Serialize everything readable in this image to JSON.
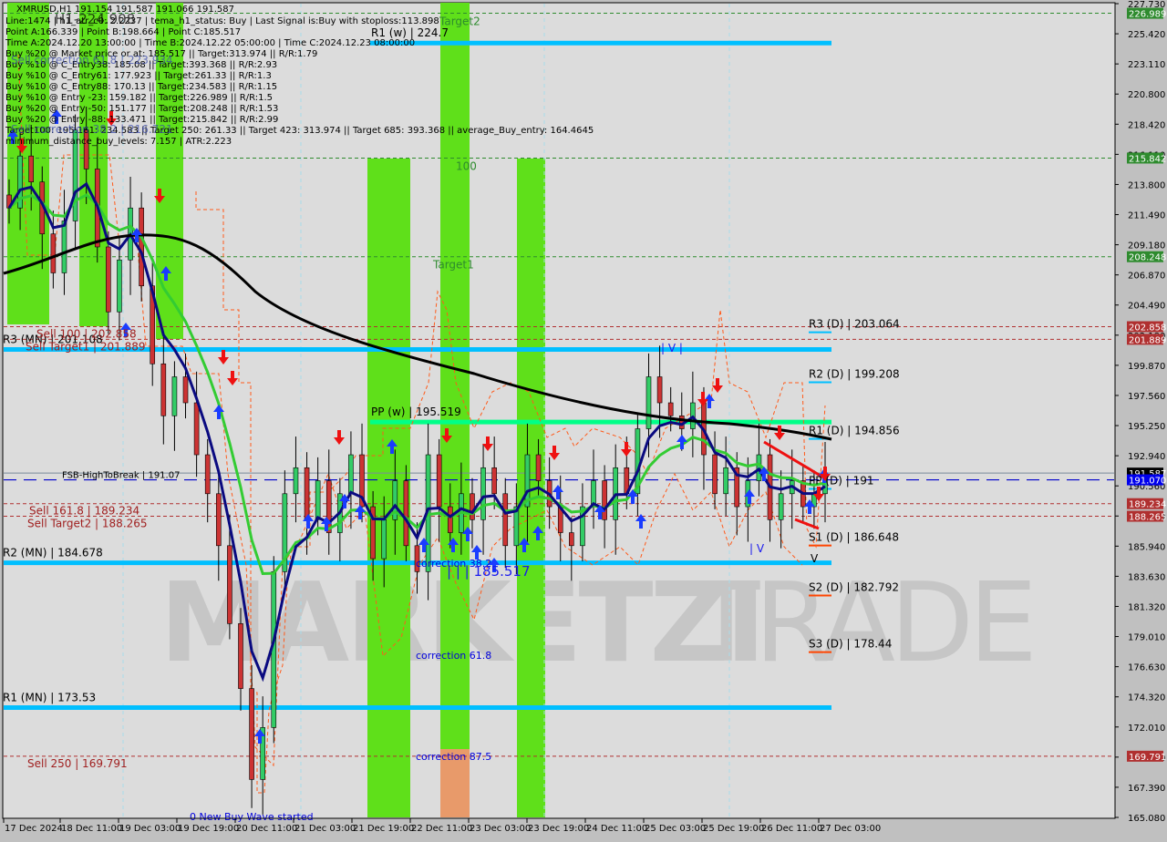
{
  "window": {
    "symbol_header": "XMRUSD,H1  191.154 191.587 191.066 191.587"
  },
  "info_panel": {
    "lines": [
      "Line:1474 | h1_atr_c0: 2.2237 | tema_h1_status: Buy | Last Signal is:Buy with stoploss:113.898",
      "Point A:166.339 | Point B:198.664 | Point C:185.517",
      "Time A:2024.12.20 13:00:00 | Time B:2024.12.22 05:00:00 | Time C:2024.12.23 08:00:00",
      "Buy %20 @ Market price or at: 185.517 || Target:313.974 || R/R:1.79",
      "Buy %10 @ C_Entry38: 185.08 || Target:393.368 || R/R:2.93",
      "Buy %10 @ C_Entry61: 177.923 || Target:261.33 || R/R:1.3",
      "Buy %10 @ C_Entry88: 170.13 || Target:234.583 || R/R:1.15",
      "Buy %10 @ Entry -23: 159.182 || Target:226.989 || R/R:1.5",
      "Buy %20 @ Entry -50: 151.177 || Target:208.248 || R/R:1.53",
      "Buy %20 @ Entry -88: 133.471 || Target:215.842 || R/R:2.99",
      "Target100: 195.161: 234.583 || Target 250: 261.33 || Target 423: 313.974 || Target 685: 393.368 || average_Buy_entry: 164.4645",
      "minimum_distance_buy_levels: 7.157 | ATR:2.223"
    ],
    "overlay_labels": [
      "Sell correction 61.8 | 223.934",
      "Sell correction 38.2 | 216.721",
      "H1-224.908"
    ]
  },
  "chart_data": {
    "type": "candlestick",
    "title": "XMRUSD,H1",
    "ohlc_last": {
      "open": 191.154,
      "high": 191.587,
      "low": 191.066,
      "close": 191.587
    },
    "ylim": [
      165.08,
      227.73
    ],
    "y_ticks": [
      "227.730",
      "225.420",
      "223.110",
      "220.800",
      "218.420",
      "216.110",
      "213.800",
      "211.490",
      "209.180",
      "206.870",
      "204.490",
      "202.180",
      "199.870",
      "197.560",
      "195.250",
      "192.940",
      "190.560",
      "188.250",
      "185.940",
      "183.630",
      "181.320",
      "179.010",
      "176.630",
      "174.320",
      "172.010",
      "169.700",
      "167.390",
      "165.080"
    ],
    "x_ticks": [
      "17 Dec 2024",
      "18 Dec 11:00",
      "19 Dec 03:00",
      "19 Dec 19:00",
      "20 Dec 11:00",
      "21 Dec 03:00",
      "21 Dec 19:00",
      "22 Dec 11:00",
      "23 Dec 03:00",
      "23 Dec 19:00",
      "24 Dec 11:00",
      "25 Dec 03:00",
      "25 Dec 19:00",
      "26 Dec 11:00",
      "27 Dec 03:00"
    ],
    "price_tags": [
      {
        "value": "226.989",
        "color": "#2e8b2e"
      },
      {
        "value": "215.842",
        "color": "#2e8b2e"
      },
      {
        "value": "208.248",
        "color": "#2e8b2e"
      },
      {
        "value": "202.858",
        "color": "#b03030"
      },
      {
        "value": "201.889",
        "color": "#b03030"
      },
      {
        "value": "191.587",
        "color": "#000000"
      },
      {
        "value": "191.070",
        "color": "#0000ee"
      },
      {
        "value": "189.234",
        "color": "#b03030"
      },
      {
        "value": "188.265",
        "color": "#b03030"
      },
      {
        "value": "169.791",
        "color": "#b03030"
      }
    ],
    "pivot_levels": [
      {
        "label": "R1 (w) | 224.7",
        "price": 224.7,
        "type": "weekly"
      },
      {
        "label": "R3 (MN) | 201.108",
        "price": 201.108,
        "type": "monthly"
      },
      {
        "label": "PP (w) | 195.519",
        "price": 195.519,
        "type": "weekly-pp"
      },
      {
        "label": "R2 (MN) | 184.678",
        "price": 184.678,
        "type": "monthly"
      },
      {
        "label": "R1 (MN) | 173.53",
        "price": 173.53,
        "type": "monthly"
      }
    ],
    "daily_levels": [
      {
        "label": "R3 (D) | 203.064",
        "price": 203.064,
        "kind": "r"
      },
      {
        "label": "R2 (D) | 199.208",
        "price": 199.208,
        "kind": "r"
      },
      {
        "label": "R1 (D) | 194.856",
        "price": 194.856,
        "kind": "r"
      },
      {
        "label": "PP (D) | 191",
        "price": 191.0,
        "kind": "pp"
      },
      {
        "label": "S1 (D) | 186.648",
        "price": 186.648,
        "kind": "s"
      },
      {
        "label": "S2 (D) | 182.792",
        "price": 182.792,
        "kind": "s"
      },
      {
        "label": "S3 (D) | 178.44",
        "price": 178.44,
        "kind": "s"
      }
    ],
    "sell_levels": [
      {
        "label": "Sell 100 | 202.858",
        "price": 202.858
      },
      {
        "label": "Sell Target1 | 201.889",
        "price": 201.889
      },
      {
        "label": "Sell 161.8 | 189.234",
        "price": 189.234
      },
      {
        "label": "Sell Target2 | 188.265",
        "price": 188.265
      },
      {
        "label": "Sell  250 | 169.791",
        "price": 169.791
      }
    ],
    "target_levels": [
      {
        "label": "Target2",
        "price": 226.989
      },
      {
        "label": "100",
        "price": 215.842
      },
      {
        "label": "Target1",
        "price": 208.248
      }
    ],
    "break_level": {
      "label": "FSB-HighToBreak | 191.07",
      "price": 191.07
    },
    "corrections": [
      {
        "label": "correction 38.2",
        "price": 185.1
      },
      {
        "label": "correction 61.8",
        "price": 177.9
      },
      {
        "label": "correction 87.5",
        "price": 170.1
      }
    ],
    "point_c_label": "| | | 185.517",
    "wave_label": "0 New Buy Wave started",
    "wave_marks": [
      "| V |",
      "| V",
      "V"
    ],
    "watermark": "MARKETZITRADE",
    "close_series_approx": [
      212,
      216,
      214,
      210,
      207,
      211,
      218,
      215,
      209,
      204,
      208,
      212,
      206,
      200,
      196,
      199,
      197,
      193,
      190,
      186,
      180,
      175,
      168,
      172,
      184,
      190,
      192,
      188,
      191,
      187,
      190,
      193,
      189,
      185,
      188,
      191,
      186,
      184,
      193,
      189,
      187,
      190,
      188,
      192,
      190,
      186,
      189,
      193,
      191,
      189,
      187,
      186,
      189,
      191,
      188,
      192,
      190,
      195,
      199,
      197,
      196,
      195,
      197,
      193,
      190,
      192,
      189,
      191,
      193,
      188,
      190,
      191,
      189,
      190,
      191.587
    ]
  },
  "colors": {
    "bg": "#d4d0c8",
    "green_zone": "#5fe01a",
    "orange_zone": "#e89a6a",
    "monthly_line": "#00bfff",
    "weekly_pp_line": "#00ff88",
    "sell_line": "#b03030",
    "target_line": "#2e8b2e",
    "ema_blue": "#0a0a80",
    "ema_green": "#33cc33",
    "ema_black": "#000000",
    "fsb_line": "#0000cc"
  }
}
